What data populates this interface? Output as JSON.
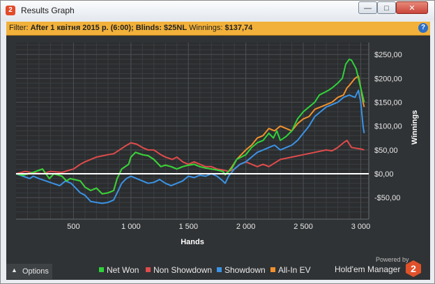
{
  "window": {
    "title": "Results Graph",
    "app_badge": "2"
  },
  "filter": {
    "prefix": "Filter:",
    "value": "After 1 квітня 2015 р. (6:00); Blinds: $25NL",
    "winnings_label": "Winnings:",
    "winnings_value": "$137,74"
  },
  "options_label": "Options",
  "powered_by": "Powered by",
  "brand": "Hold'em Manager",
  "brand_badge": "2",
  "colors": {
    "net_won": "#2fd33a",
    "non_showdown": "#e04b4b",
    "showdown": "#3a93e6",
    "all_in_ev": "#f2912c",
    "plot_bg": "#2b2d2f",
    "filter_bar": "#f2b13a"
  },
  "chart_data": {
    "type": "line",
    "xlabel": "Hands",
    "ylabel": "Winnings",
    "xlim": [
      0,
      3070
    ],
    "ylim": [
      -95,
      275
    ],
    "x_ticks": [
      500,
      1000,
      1500,
      2000,
      2500,
      3000
    ],
    "x_tick_labels": [
      "500",
      "1 000",
      "1 500",
      "2 000",
      "2 500",
      "3 000"
    ],
    "y_ticks": [
      250,
      200,
      150,
      100,
      50,
      0,
      -50
    ],
    "y_tick_labels": [
      "$250,00",
      "$200,00",
      "$150,00",
      "$100,00",
      "$50,00",
      "$0,00",
      "-$50,00"
    ],
    "grid": true,
    "zero_line": true,
    "legend_position": "bottom",
    "series": [
      {
        "name": "Net Won",
        "color": "#2fd33a",
        "points": [
          [
            0,
            0
          ],
          [
            60,
            -3
          ],
          [
            150,
            3
          ],
          [
            230,
            10
          ],
          [
            290,
            -10
          ],
          [
            330,
            0
          ],
          [
            400,
            -5
          ],
          [
            440,
            -15
          ],
          [
            470,
            -10
          ],
          [
            560,
            -15
          ],
          [
            600,
            -28
          ],
          [
            650,
            -35
          ],
          [
            700,
            -30
          ],
          [
            750,
            -42
          ],
          [
            800,
            -40
          ],
          [
            850,
            -35
          ],
          [
            880,
            -10
          ],
          [
            920,
            10
          ],
          [
            980,
            20
          ],
          [
            1000,
            35
          ],
          [
            1040,
            45
          ],
          [
            1100,
            40
          ],
          [
            1150,
            38
          ],
          [
            1200,
            30
          ],
          [
            1260,
            15
          ],
          [
            1300,
            18
          ],
          [
            1350,
            15
          ],
          [
            1400,
            10
          ],
          [
            1450,
            15
          ],
          [
            1500,
            18
          ],
          [
            1550,
            20
          ],
          [
            1600,
            15
          ],
          [
            1650,
            12
          ],
          [
            1700,
            10
          ],
          [
            1750,
            8
          ],
          [
            1800,
            5
          ],
          [
            1820,
            -2
          ],
          [
            1850,
            5
          ],
          [
            1880,
            12
          ],
          [
            1920,
            30
          ],
          [
            1960,
            35
          ],
          [
            2000,
            40
          ],
          [
            2050,
            55
          ],
          [
            2100,
            65
          ],
          [
            2150,
            70
          ],
          [
            2200,
            85
          ],
          [
            2240,
            75
          ],
          [
            2270,
            90
          ],
          [
            2300,
            70
          ],
          [
            2350,
            78
          ],
          [
            2400,
            90
          ],
          [
            2450,
            115
          ],
          [
            2500,
            130
          ],
          [
            2550,
            140
          ],
          [
            2600,
            150
          ],
          [
            2640,
            165
          ],
          [
            2680,
            170
          ],
          [
            2720,
            175
          ],
          [
            2750,
            180
          ],
          [
            2800,
            190
          ],
          [
            2840,
            200
          ],
          [
            2870,
            230
          ],
          [
            2900,
            240
          ],
          [
            2920,
            238
          ],
          [
            2960,
            220
          ],
          [
            3000,
            180
          ],
          [
            3020,
            160
          ],
          [
            3030,
            150
          ]
        ]
      },
      {
        "name": "Non Showdown",
        "color": "#e04b4b",
        "points": [
          [
            0,
            0
          ],
          [
            80,
            5
          ],
          [
            150,
            2
          ],
          [
            230,
            0
          ],
          [
            300,
            5
          ],
          [
            400,
            3
          ],
          [
            500,
            10
          ],
          [
            560,
            20
          ],
          [
            600,
            25
          ],
          [
            700,
            35
          ],
          [
            800,
            40
          ],
          [
            850,
            42
          ],
          [
            900,
            50
          ],
          [
            950,
            58
          ],
          [
            1000,
            65
          ],
          [
            1050,
            62
          ],
          [
            1100,
            55
          ],
          [
            1150,
            50
          ],
          [
            1200,
            50
          ],
          [
            1260,
            40
          ],
          [
            1300,
            35
          ],
          [
            1360,
            30
          ],
          [
            1400,
            35
          ],
          [
            1450,
            25
          ],
          [
            1500,
            20
          ],
          [
            1550,
            25
          ],
          [
            1600,
            20
          ],
          [
            1650,
            15
          ],
          [
            1700,
            15
          ],
          [
            1750,
            10
          ],
          [
            1800,
            8
          ],
          [
            1850,
            5
          ],
          [
            1900,
            10
          ],
          [
            1950,
            20
          ],
          [
            2000,
            25
          ],
          [
            2100,
            15
          ],
          [
            2150,
            20
          ],
          [
            2200,
            15
          ],
          [
            2300,
            30
          ],
          [
            2400,
            35
          ],
          [
            2500,
            40
          ],
          [
            2600,
            45
          ],
          [
            2700,
            50
          ],
          [
            2750,
            48
          ],
          [
            2800,
            55
          ],
          [
            2850,
            65
          ],
          [
            2880,
            70
          ],
          [
            2920,
            55
          ],
          [
            3000,
            52
          ],
          [
            3030,
            50
          ]
        ]
      },
      {
        "name": "Showdown",
        "color": "#3a93e6",
        "points": [
          [
            0,
            0
          ],
          [
            60,
            -5
          ],
          [
            120,
            -10
          ],
          [
            150,
            -5
          ],
          [
            200,
            -10
          ],
          [
            260,
            -15
          ],
          [
            320,
            -20
          ],
          [
            380,
            -25
          ],
          [
            430,
            -15
          ],
          [
            480,
            -20
          ],
          [
            520,
            -30
          ],
          [
            560,
            -40
          ],
          [
            600,
            -45
          ],
          [
            650,
            -58
          ],
          [
            700,
            -60
          ],
          [
            750,
            -62
          ],
          [
            800,
            -60
          ],
          [
            850,
            -55
          ],
          [
            880,
            -40
          ],
          [
            920,
            -20
          ],
          [
            960,
            -10
          ],
          [
            1000,
            -5
          ],
          [
            1050,
            -10
          ],
          [
            1100,
            -15
          ],
          [
            1150,
            -20
          ],
          [
            1200,
            -18
          ],
          [
            1250,
            -12
          ],
          [
            1300,
            -20
          ],
          [
            1350,
            -25
          ],
          [
            1400,
            -20
          ],
          [
            1450,
            -15
          ],
          [
            1500,
            -5
          ],
          [
            1550,
            -8
          ],
          [
            1600,
            -3
          ],
          [
            1650,
            -5
          ],
          [
            1700,
            0
          ],
          [
            1750,
            -5
          ],
          [
            1800,
            -15
          ],
          [
            1820,
            -20
          ],
          [
            1850,
            -5
          ],
          [
            1900,
            10
          ],
          [
            1950,
            20
          ],
          [
            2000,
            25
          ],
          [
            2050,
            35
          ],
          [
            2100,
            45
          ],
          [
            2150,
            50
          ],
          [
            2200,
            55
          ],
          [
            2250,
            60
          ],
          [
            2300,
            50
          ],
          [
            2350,
            55
          ],
          [
            2400,
            60
          ],
          [
            2450,
            70
          ],
          [
            2500,
            85
          ],
          [
            2550,
            100
          ],
          [
            2600,
            120
          ],
          [
            2650,
            130
          ],
          [
            2700,
            140
          ],
          [
            2750,
            145
          ],
          [
            2800,
            150
          ],
          [
            2850,
            160
          ],
          [
            2900,
            165
          ],
          [
            2950,
            160
          ],
          [
            2980,
            175
          ],
          [
            3000,
            150
          ],
          [
            3020,
            100
          ],
          [
            3030,
            85
          ]
        ]
      },
      {
        "name": "All-In EV",
        "color": "#f2912c",
        "points": [
          [
            0,
            0
          ],
          [
            60,
            -3
          ],
          [
            150,
            3
          ],
          [
            230,
            10
          ],
          [
            290,
            -10
          ],
          [
            330,
            0
          ],
          [
            400,
            -5
          ],
          [
            440,
            -15
          ],
          [
            470,
            -10
          ],
          [
            560,
            -15
          ],
          [
            600,
            -28
          ],
          [
            650,
            -35
          ],
          [
            700,
            -30
          ],
          [
            750,
            -42
          ],
          [
            800,
            -40
          ],
          [
            850,
            -35
          ],
          [
            880,
            -10
          ],
          [
            920,
            10
          ],
          [
            980,
            20
          ],
          [
            1000,
            35
          ],
          [
            1040,
            45
          ],
          [
            1100,
            40
          ],
          [
            1150,
            38
          ],
          [
            1200,
            30
          ],
          [
            1260,
            15
          ],
          [
            1300,
            18
          ],
          [
            1350,
            15
          ],
          [
            1400,
            10
          ],
          [
            1450,
            15
          ],
          [
            1500,
            18
          ],
          [
            1550,
            20
          ],
          [
            1600,
            15
          ],
          [
            1650,
            12
          ],
          [
            1700,
            10
          ],
          [
            1750,
            8
          ],
          [
            1800,
            5
          ],
          [
            1820,
            -2
          ],
          [
            1850,
            5
          ],
          [
            1880,
            15
          ],
          [
            1920,
            30
          ],
          [
            1960,
            40
          ],
          [
            2000,
            50
          ],
          [
            2050,
            60
          ],
          [
            2100,
            75
          ],
          [
            2150,
            80
          ],
          [
            2200,
            95
          ],
          [
            2250,
            90
          ],
          [
            2300,
            100
          ],
          [
            2350,
            95
          ],
          [
            2400,
            90
          ],
          [
            2450,
            105
          ],
          [
            2500,
            115
          ],
          [
            2550,
            120
          ],
          [
            2600,
            135
          ],
          [
            2650,
            140
          ],
          [
            2700,
            145
          ],
          [
            2750,
            150
          ],
          [
            2800,
            160
          ],
          [
            2850,
            165
          ],
          [
            2880,
            180
          ],
          [
            2900,
            185
          ],
          [
            2950,
            200
          ],
          [
            2980,
            205
          ],
          [
            3000,
            180
          ],
          [
            3020,
            150
          ],
          [
            3030,
            140
          ]
        ]
      }
    ]
  }
}
